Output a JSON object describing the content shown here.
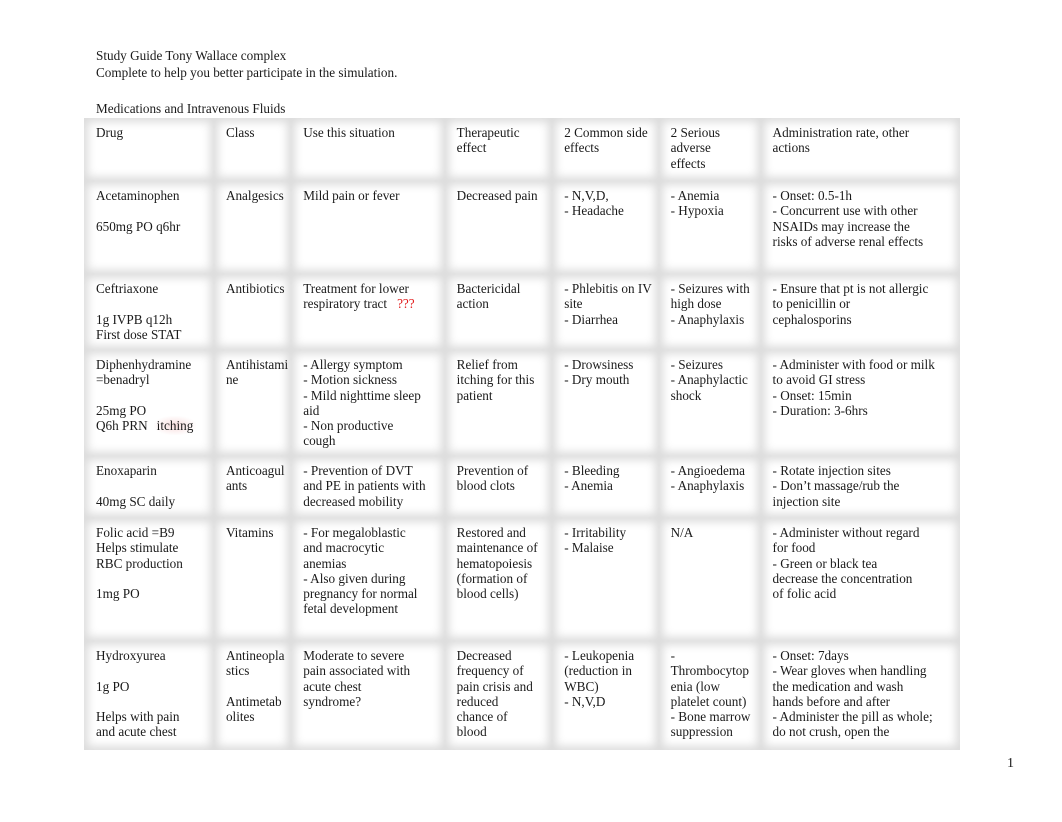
{
  "header": {
    "title": "Study Guide Tony Wallace complex",
    "subtitle": "Complete to help you better participate in the simulation.",
    "section": "Medications and Intravenous Fluids"
  },
  "table": {
    "columns": [
      "Drug",
      "Class",
      "Use this situation",
      "Therapeutic\neffect",
      "2 Common side\neffects",
      "2 Serious\nadverse\neffects",
      "Administration rate, other\nactions"
    ],
    "rows": [
      {
        "drug": "Acetaminophen\n\n650mg PO q6hr",
        "class": "Analgesics",
        "use": "Mild pain or fever",
        "use_note": "",
        "therapeutic": "Decreased pain",
        "common": "- N,V,D,\n- Headache",
        "serious": "- Anemia\n- Hypoxia",
        "admin": "- Onset: 0.5-1h\n- Concurrent use with other\nNSAIDs may increase the\nrisks of adverse renal effects"
      },
      {
        "drug": "Ceftriaxone\n\n1g IVPB q12h\nFirst dose STAT",
        "class": "Antibiotics",
        "use": "Treatment for lower\nrespiratory tract",
        "use_note": "???",
        "therapeutic": "Bactericidal\naction",
        "common": "- Phlebitis on IV\nsite\n- Diarrhea",
        "serious": "- Seizures with\nhigh dose\n- Anaphylaxis",
        "admin": "- Ensure that pt is not allergic\nto penicillin or\ncephalosporins"
      },
      {
        "drug": "Diphenhydramine\n=benadryl\n\n25mg PO\nQ6h PRN",
        "drug_note": "itching",
        "class": "Antihistami\nne",
        "use": "- Allergy symptom\n- Motion sickness\n- Mild nighttime sleep\naid\n- Non productive\ncough",
        "use_note": "",
        "therapeutic": "Relief from\nitching for this\npatient",
        "common": "- Drowsiness\n- Dry mouth",
        "serious": "- Seizures\n- Anaphylactic\nshock",
        "admin": "- Administer with food or milk\nto avoid GI stress\n- Onset: 15min\n- Duration: 3-6hrs"
      },
      {
        "drug": "Enoxaparin\n\n40mg SC daily",
        "class": "Anticoagul\nants",
        "use": "- Prevention of DVT\nand PE in patients with\ndecreased mobility",
        "use_note": "",
        "therapeutic": "Prevention of\nblood clots",
        "common": "- Bleeding\n- Anemia",
        "serious": "- Angioedema\n- Anaphylaxis",
        "admin": "- Rotate injection sites\n- Don’t massage/rub the\ninjection site"
      },
      {
        "drug": "Folic acid    =B9\nHelps stimulate\nRBC production\n\n1mg PO",
        "class": "Vitamins",
        "use": "- For megaloblastic\nand macrocytic\nanemias\n- Also given during\npregnancy for normal\nfetal development",
        "use_note": "",
        "therapeutic": "Restored and\nmaintenance of\nhematopoiesis\n(formation of\nblood cells)",
        "common": "- Irritability\n- Malaise",
        "serious": "N/A",
        "admin": "- Administer without regard\nfor food\n- Green or black tea\ndecrease the concentration\nof folic acid"
      },
      {
        "drug": "Hydroxyurea\n\n1g PO\n\nHelps with pain\nand acute chest",
        "class": "Antineopla\nstics\n\nAntimetab\nolites",
        "use": "Moderate to severe\npain associated with\nacute chest\nsyndrome?",
        "use_note": "",
        "therapeutic": "Decreased\nfrequency of\npain crisis and\nreduced\nchance of\nblood",
        "common": "- Leukopenia\n(reduction in\nWBC)\n- N,V,D",
        "serious": "-\nThrombocytop\nenia (low\nplatelet count)\n- Bone marrow\nsuppression",
        "admin": "- Onset: 7days\n- Wear gloves when handling\nthe medication and wash\nhands before and after\n- Administer the pill as whole;\ndo not crush, open the"
      }
    ]
  },
  "footer": {
    "page_number": "1"
  }
}
